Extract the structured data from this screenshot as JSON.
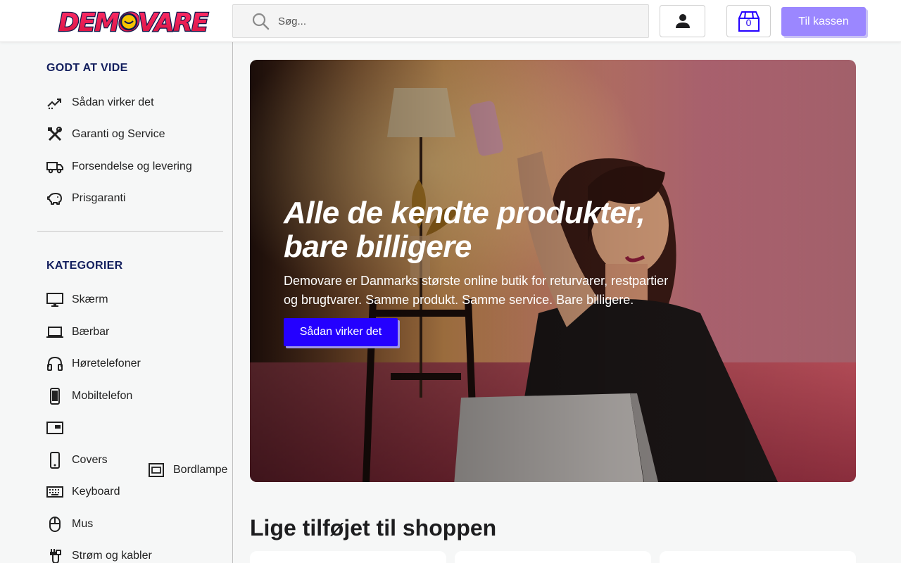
{
  "brand": {
    "name": "DEMOVARE",
    "accent": "#2400ff",
    "logo_red": "#e8174a",
    "logo_yellow": "#f5c400",
    "logo_navy": "#101a4e"
  },
  "header": {
    "search_placeholder": "Søg...",
    "account_icon": "person-icon",
    "cart_count": "0",
    "checkout_label": "Til kassen"
  },
  "sidebar": {
    "good_to_know": {
      "title": "GODT AT VIDE",
      "items": [
        {
          "label": "Sådan virker det",
          "icon": "trending-icon"
        },
        {
          "label": "Garanti og Service",
          "icon": "tools-icon"
        },
        {
          "label": "Forsendelse og levering",
          "icon": "truck-icon"
        },
        {
          "label": "Prisgaranti",
          "icon": "piggy-bank-icon"
        }
      ]
    },
    "categories": {
      "title": "KATEGORIER",
      "items": [
        {
          "label": "Skærm",
          "icon": "monitor-icon"
        },
        {
          "label": "Bærbar",
          "icon": "laptop-icon"
        },
        {
          "label": "Høretelefoner",
          "icon": "headphones-icon"
        },
        {
          "label": "Mobiltelefon",
          "icon": "smartphone-icon"
        },
        {
          "label": "",
          "icon": "tablet-icon"
        },
        {
          "label": "Covers",
          "icon": "phone-cover-icon"
        },
        {
          "label": "Keyboard",
          "icon": "keyboard-icon"
        },
        {
          "label": "Mus",
          "icon": "mouse-icon"
        },
        {
          "label": "Strøm og kabler",
          "icon": "cable-icon"
        }
      ],
      "extra": {
        "label": "Bordlampe",
        "icon": "picture-in-picture-icon"
      }
    }
  },
  "hero": {
    "title_line1": "Alle de kendte produkter,",
    "title_line2": "bare billigere",
    "text": "Demovare er Danmarks største online butik for returvarer, restpartier og brugtvarer. Samme produkt. Samme service. Bare billigere.",
    "button_label": "Sådan virker det"
  },
  "recent": {
    "heading": "Lige tilføjet til shoppen"
  }
}
